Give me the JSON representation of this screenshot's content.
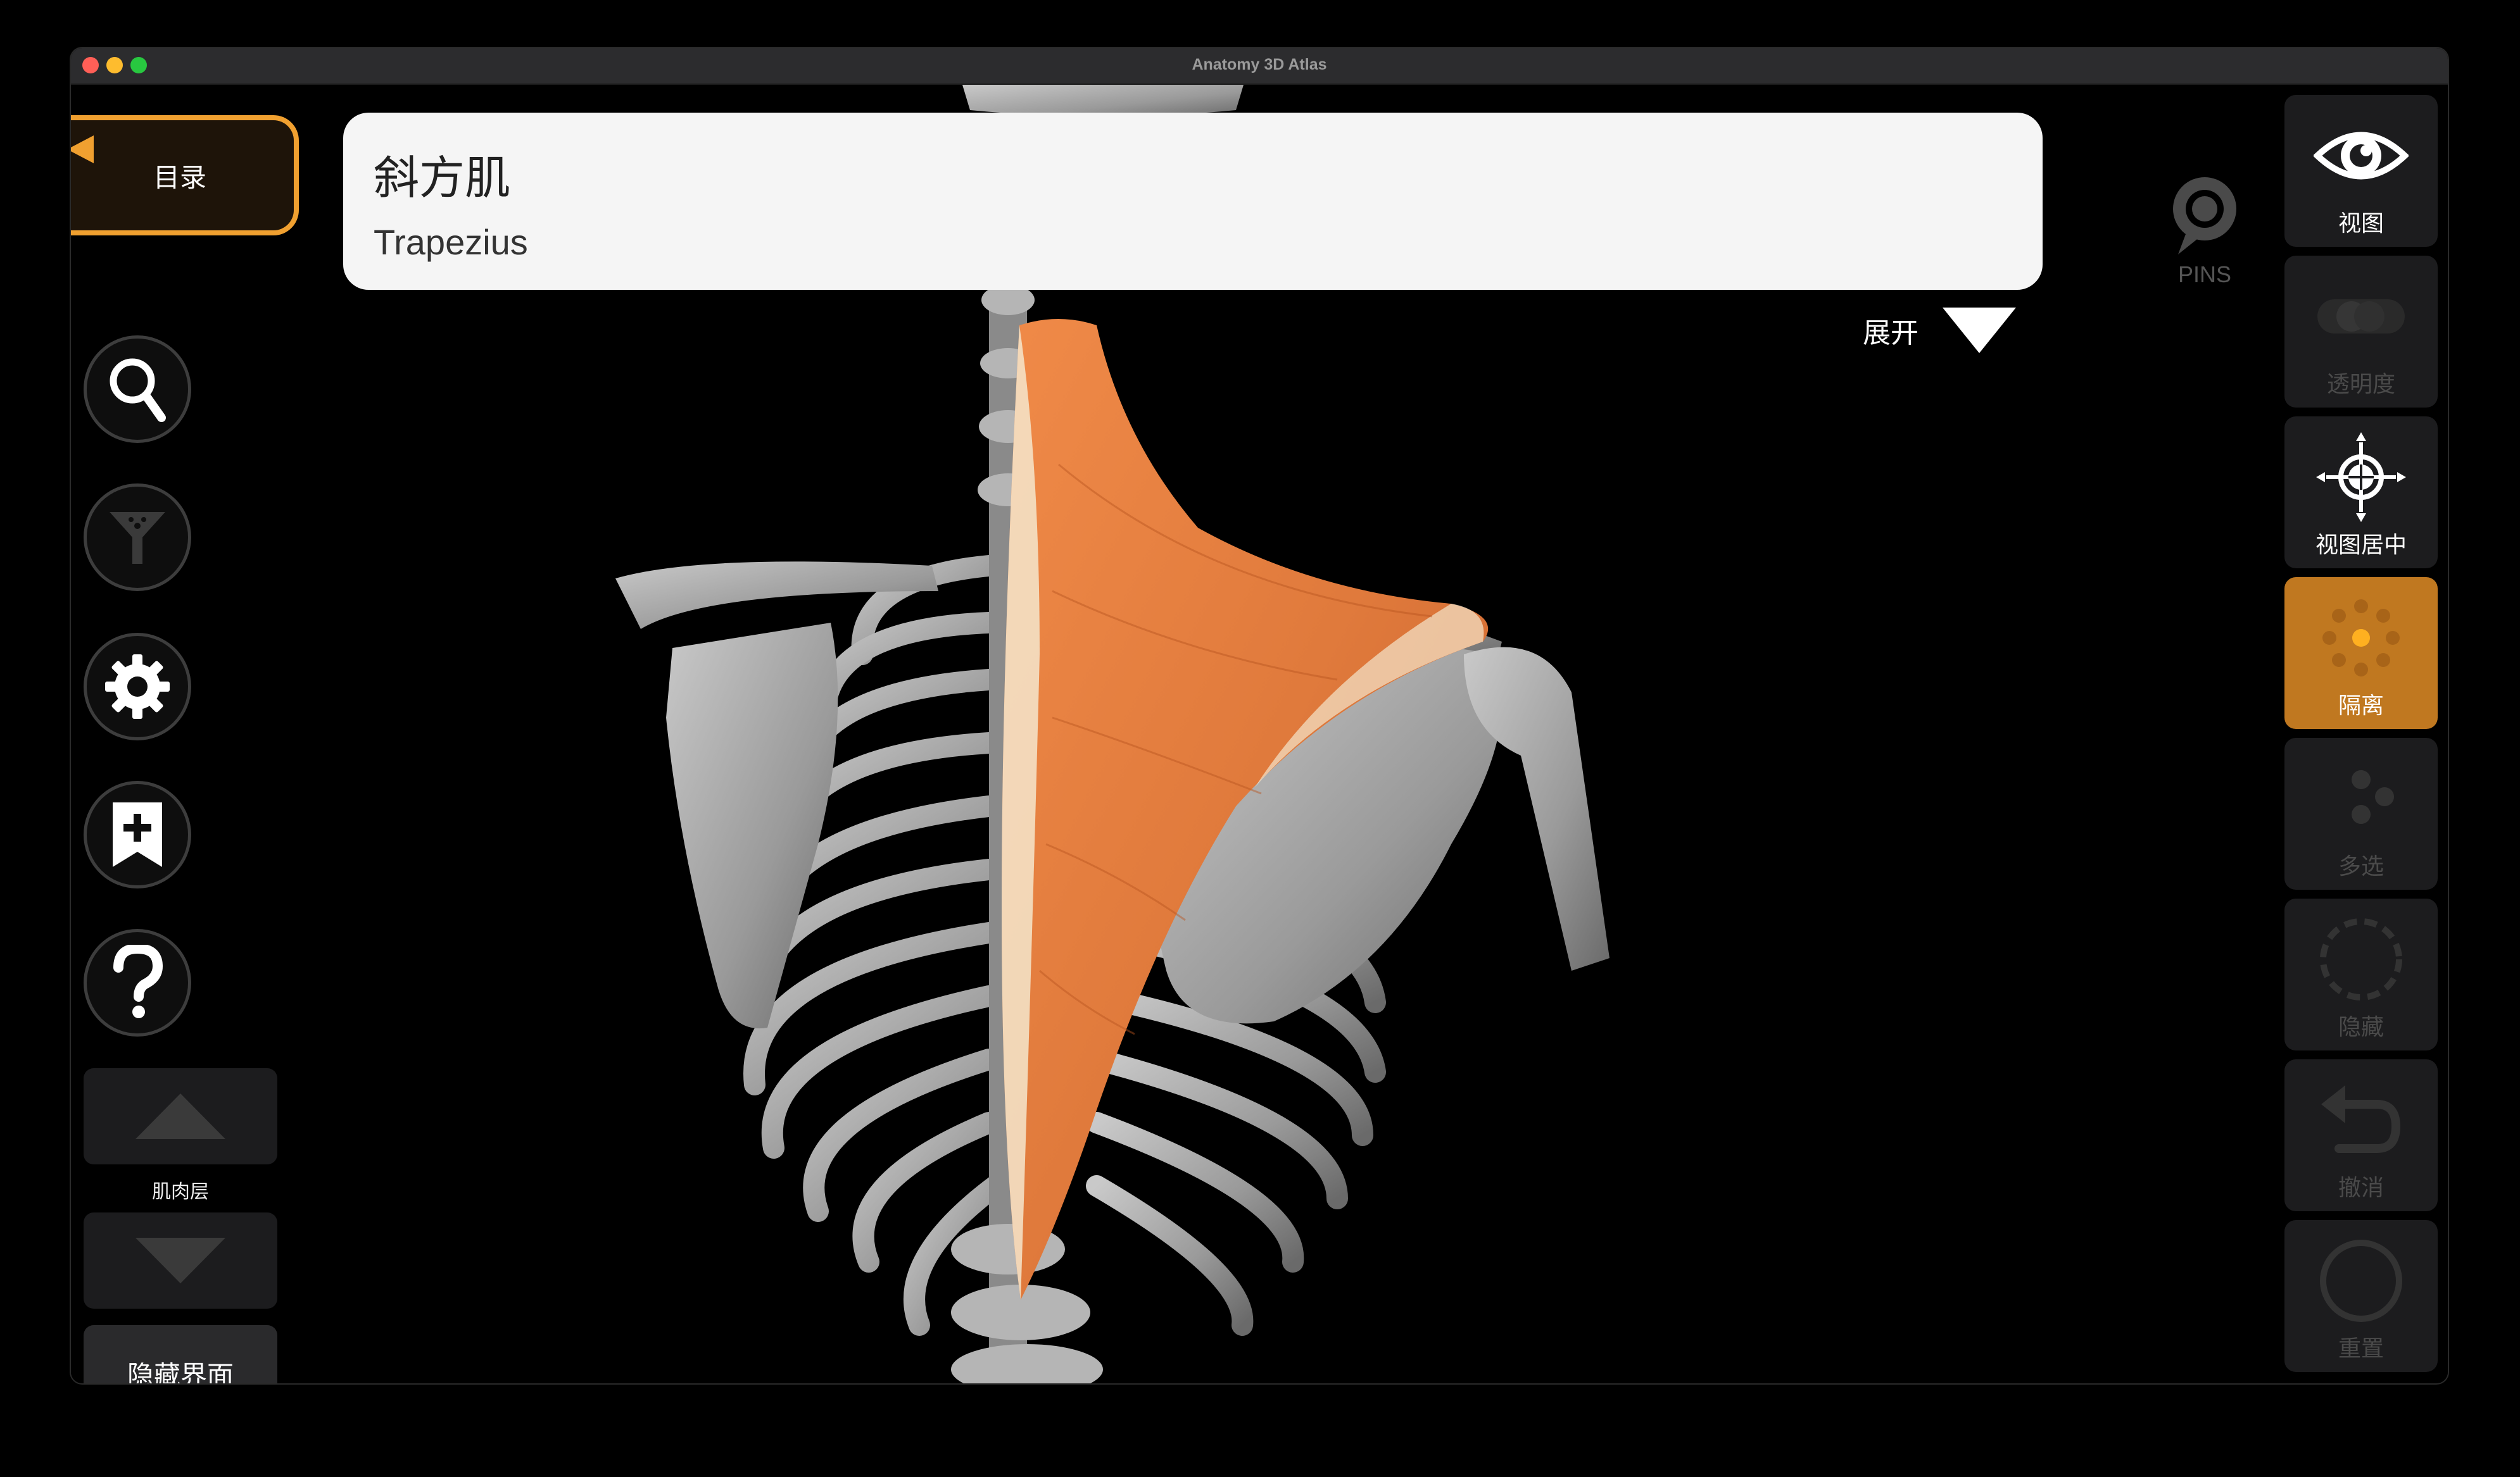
{
  "window": {
    "title": "Anatomy 3D Atlas"
  },
  "left_toolbar": {
    "menu_label": "目录",
    "layer_label": "肌肉层",
    "hide_ui_label": "隐藏界面",
    "buttons": [
      "search-icon",
      "filter-icon",
      "gear-icon",
      "bookmark-add-icon",
      "help-icon"
    ]
  },
  "info_panel": {
    "name_zh": "斜方肌",
    "name_en": "Trapezius",
    "expand_label": "展开"
  },
  "pins": {
    "label": "PINS"
  },
  "right_toolbar": {
    "view": "视图",
    "transparency": "透明度",
    "center_view": "视图居中",
    "isolate": "隔离",
    "multi_select": "多选",
    "hide": "隐藏",
    "undo": "撤消",
    "reset": "重置"
  },
  "colors": {
    "accent": "#f0a030",
    "active_button": "#c07820",
    "muscle": "#e07a3c",
    "bone": "#a8a8a8"
  }
}
